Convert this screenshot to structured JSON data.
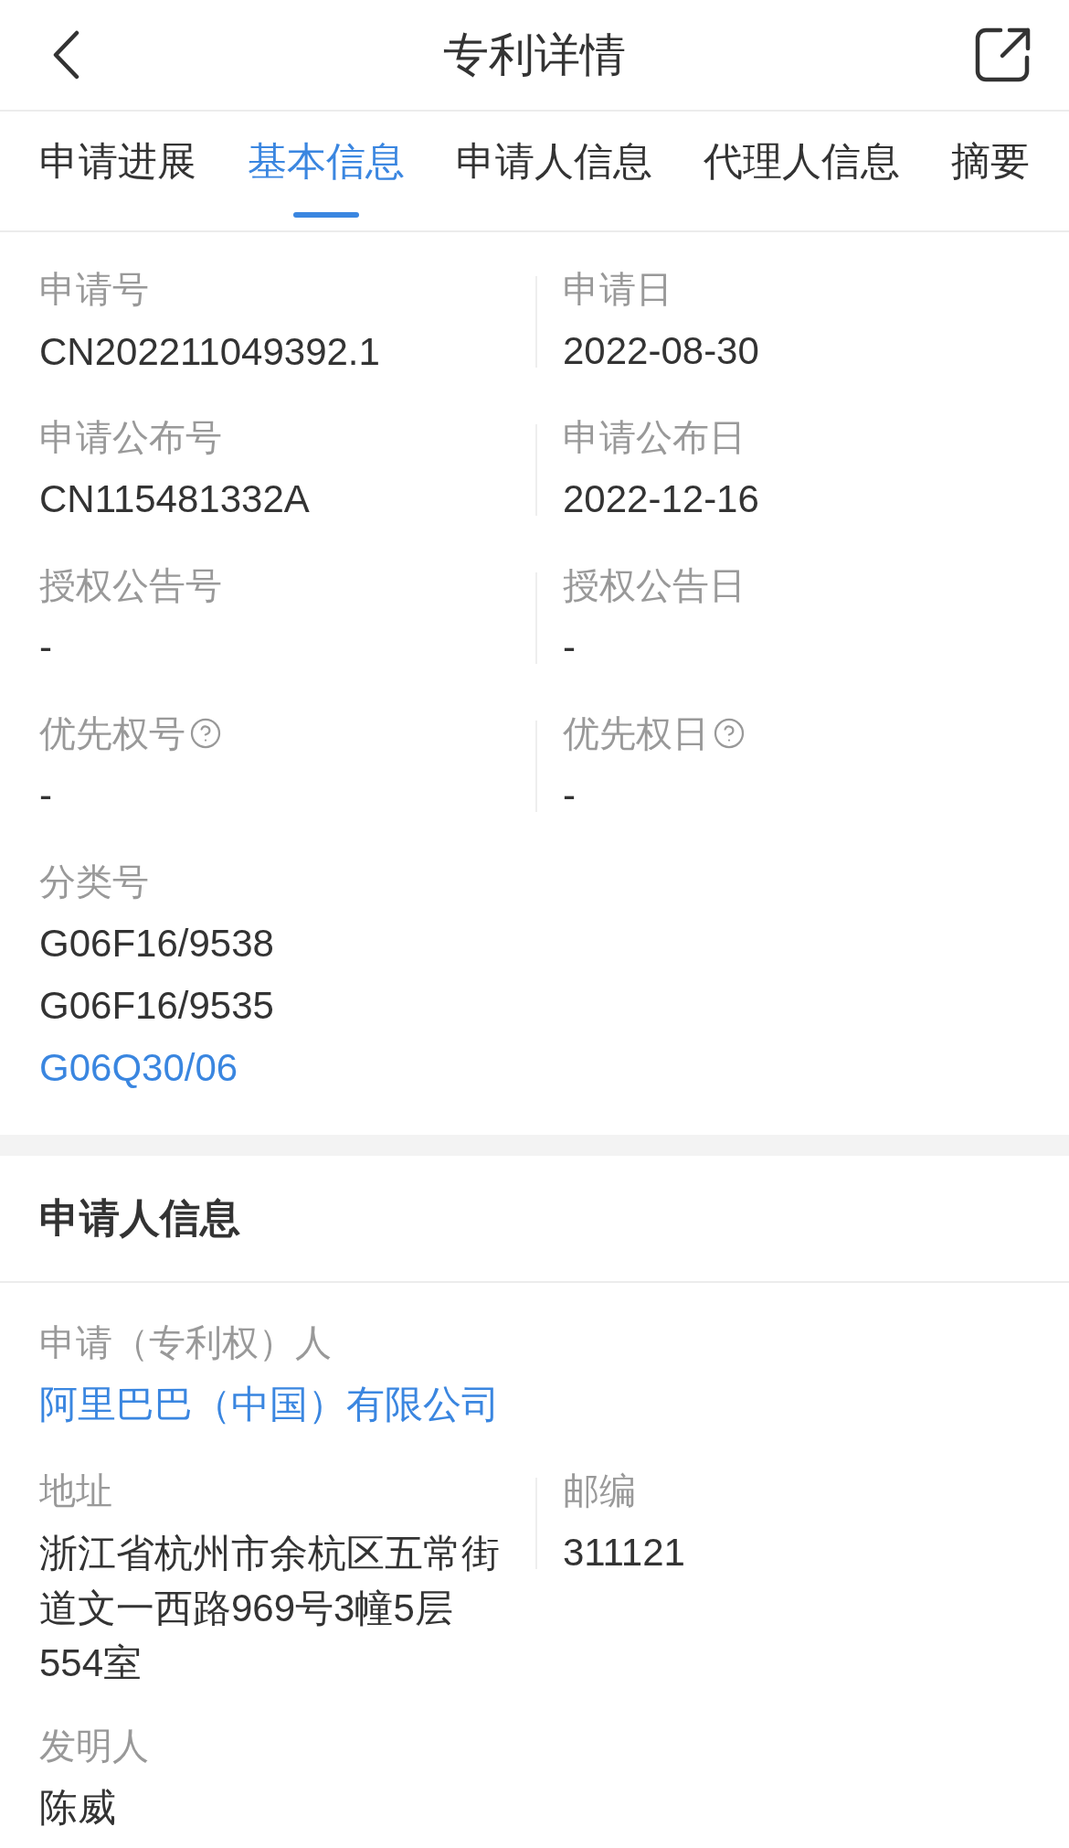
{
  "header": {
    "title": "专利详情"
  },
  "tabs": [
    {
      "label": "申请进展",
      "selected": false
    },
    {
      "label": "基本信息",
      "selected": true
    },
    {
      "label": "申请人信息",
      "selected": false
    },
    {
      "label": "代理人信息",
      "selected": false
    },
    {
      "label": "摘要",
      "selected": false
    }
  ],
  "basic_info": {
    "rows": [
      [
        {
          "label": "申请号",
          "help": false,
          "values": [
            {
              "text": "CN202211049392.1",
              "kind": "text"
            }
          ]
        },
        {
          "label": "申请日",
          "help": false,
          "values": [
            {
              "text": "2022-08-30",
              "kind": "text"
            }
          ]
        }
      ],
      [
        {
          "label": "申请公布号",
          "help": false,
          "values": [
            {
              "text": "CN115481332A",
              "kind": "text"
            }
          ]
        },
        {
          "label": "申请公布日",
          "help": false,
          "values": [
            {
              "text": "2022-12-16",
              "kind": "text"
            }
          ]
        }
      ],
      [
        {
          "label": "授权公告号",
          "help": false,
          "values": [
            {
              "text": "-",
              "kind": "text"
            }
          ]
        },
        {
          "label": "授权公告日",
          "help": false,
          "values": [
            {
              "text": "-",
              "kind": "text"
            }
          ]
        }
      ],
      [
        {
          "label": "优先权号",
          "help": true,
          "values": [
            {
              "text": "-",
              "kind": "text"
            }
          ]
        },
        {
          "label": "优先权日",
          "help": true,
          "values": [
            {
              "text": "-",
              "kind": "text"
            }
          ]
        }
      ],
      [
        {
          "label": "分类号",
          "help": false,
          "values": [
            {
              "text": "G06F16/9538",
              "kind": "text"
            },
            {
              "text": "G06F16/9535",
              "kind": "text"
            },
            {
              "text": "G06Q30/06",
              "kind": "link"
            }
          ]
        }
      ]
    ]
  },
  "applicant_info": {
    "title": "申请人信息",
    "rows": [
      [
        {
          "label": "申请（专利权）人",
          "help": false,
          "values": [
            {
              "text": "阿里巴巴（中国）有限公司",
              "kind": "link"
            }
          ]
        }
      ],
      [
        {
          "label": "地址",
          "help": false,
          "values": [
            {
              "text": "浙江省杭州市余杭区五常街道文一西路969号3幢5层554室",
              "kind": "text"
            }
          ]
        },
        {
          "label": "邮编",
          "help": false,
          "values": [
            {
              "text": "311121",
              "kind": "text"
            }
          ]
        }
      ],
      [
        {
          "label": "发明人",
          "help": false,
          "values": [
            {
              "text": "陈威",
              "kind": "text"
            }
          ]
        }
      ]
    ]
  }
}
